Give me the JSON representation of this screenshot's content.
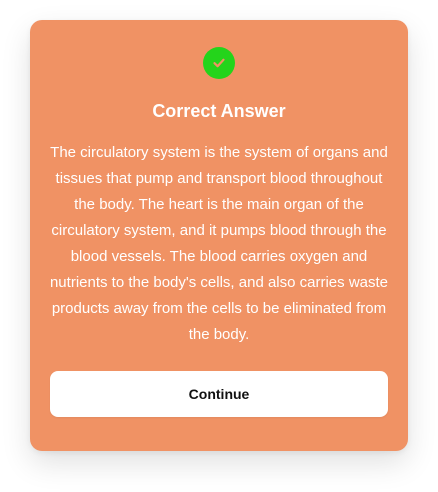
{
  "dialog": {
    "icon": "check-circle-icon",
    "title": "Correct Answer",
    "message": "The circulatory system is the system of organs and tissues that pump and transport blood throughout the body. The heart is the main organ of the circulatory system, and it pumps blood through the blood vessels. The blood carries oxygen and nutrients to the body's cells, and also carries waste products away from the cells to be eliminated from the body.",
    "continue_label": "Continue"
  },
  "colors": {
    "card_background": "#f09264",
    "success": "#24d41b",
    "button_background": "#ffffff",
    "text_on_card": "#ffffff",
    "button_text": "#111111"
  }
}
